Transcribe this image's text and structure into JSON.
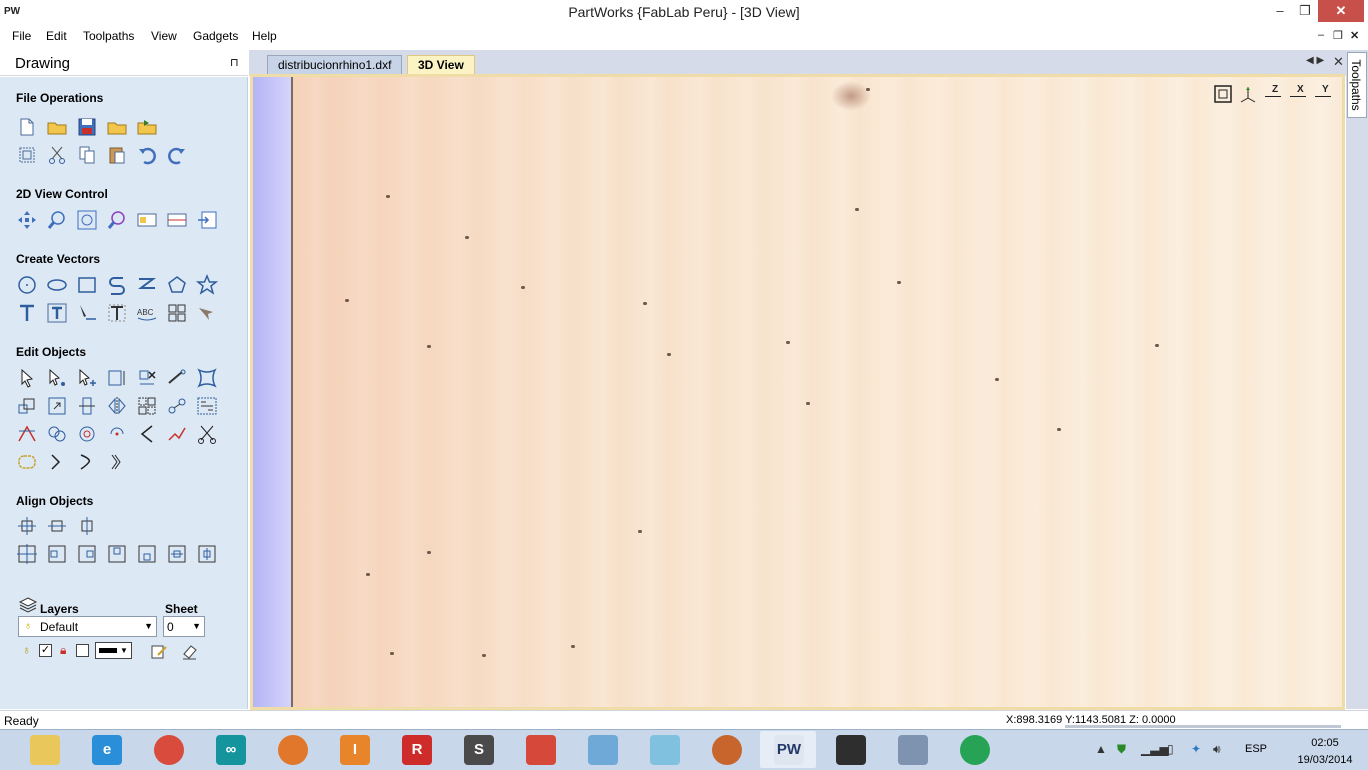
{
  "window": {
    "app_icon": "PW",
    "title": "PartWorks {FabLab Peru} - [3D View]",
    "controls": [
      "minimize-icon",
      "restore-icon",
      "close-icon"
    ],
    "minimize": "–",
    "restore": "❐",
    "close": "✕"
  },
  "menu": {
    "items": [
      "File",
      "Edit",
      "Toolpaths",
      "View",
      "Gadgets",
      "Help"
    ],
    "mdi_minimize": "–",
    "mdi_restore": "❐",
    "mdi_close": "✕"
  },
  "panel": {
    "title": "Drawing",
    "pin": "⊓",
    "sections": {
      "file_operations": "File Operations",
      "view_control": "2D View Control",
      "create_vectors": "Create Vectors",
      "edit_objects": "Edit Objects",
      "align_objects": "Align Objects"
    },
    "layers": {
      "label": "Layers",
      "sheet_label": "Sheet",
      "layer_value": "Default",
      "sheet_value": "0"
    }
  },
  "tabs": [
    {
      "label": "distribucionrhino1.dxf",
      "active": false
    },
    {
      "label": "3D View",
      "active": true
    }
  ],
  "side_tab": "Toolpaths",
  "view_tools": [
    "zoom-extents-icon",
    "iso-view-icon",
    "view-z-icon",
    "view-x-icon",
    "view-y-icon"
  ],
  "view_tool_labels": {
    "z": "Z",
    "x": "X",
    "y": "Y"
  },
  "status": {
    "text": "Ready",
    "coords": "X:898.3169 Y:1143.5081 Z:  0.0000"
  },
  "taskbar": {
    "apps": [
      {
        "name": "file-explorer-icon",
        "color": "#e9c75a",
        "glyph": ""
      },
      {
        "name": "internet-explorer-icon",
        "color": "#2a8fd8",
        "glyph": "e"
      },
      {
        "name": "chrome-icon",
        "color": "#d94b3c",
        "glyph": ""
      },
      {
        "name": "arduino-icon",
        "color": "#14949c",
        "glyph": "∞"
      },
      {
        "name": "firefox-icon",
        "color": "#e0772a",
        "glyph": ""
      },
      {
        "name": "inventor-icon",
        "color": "#e8842a",
        "glyph": "I"
      },
      {
        "name": "r-app-icon",
        "color": "#ce2b2b",
        "glyph": "R"
      },
      {
        "name": "sublime-text-icon",
        "color": "#4a4a4a",
        "glyph": "S"
      },
      {
        "name": "presentation-app-icon",
        "color": "#d6483a",
        "glyph": ""
      },
      {
        "name": "paint-icon",
        "color": "#6fa9d8",
        "glyph": ""
      },
      {
        "name": "eraser-app-icon",
        "color": "#7fc1de",
        "glyph": ""
      },
      {
        "name": "baseball-glove-app-icon",
        "color": "#c7652d",
        "glyph": ""
      },
      {
        "name": "partworks-taskbar-icon",
        "color": "#dfe6f0",
        "glyph": "PW"
      },
      {
        "name": "rhino-icon",
        "color": "#2e2e2e",
        "glyph": ""
      },
      {
        "name": "calculator-icon",
        "color": "#7d93b0",
        "glyph": ""
      },
      {
        "name": "hangouts-icon",
        "color": "#26a354",
        "glyph": ""
      }
    ]
  },
  "tray": {
    "language": "ESP",
    "time": "02:05",
    "date": "19/03/2014"
  },
  "colors": {
    "panel_bg": "#dde8f5",
    "tab_active": "#fbf3c4",
    "wood": "#f9e6d2",
    "close_red": "#c7504b"
  }
}
